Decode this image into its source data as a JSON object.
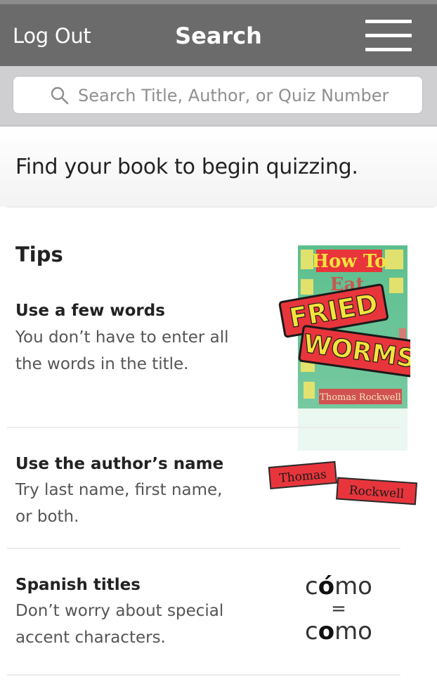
{
  "nav": {
    "logout_label": "Log Out",
    "title": "Search",
    "menu_icon": "hamburger-menu-icon"
  },
  "search": {
    "placeholder": "Search Title, Author, or Quiz Number",
    "icon": "search-icon"
  },
  "intro": {
    "text": "Find your book to begin quizzing."
  },
  "tips": {
    "heading": "Tips",
    "items": [
      {
        "title": "Use a few words",
        "desc_line1": "You don’t have to enter all",
        "desc_line2": "the words in the title."
      },
      {
        "title": "Use the author’s name",
        "desc_line1": "Try last name, first name,",
        "desc_line2": "or both."
      },
      {
        "title": "Spanish titles",
        "desc_line1": "Don’t worry about special",
        "desc_line2": "accent characters."
      }
    ]
  },
  "book_cover": {
    "line1": "How To",
    "line2": "Eat",
    "line3": "FRIED",
    "line4": "WORMS",
    "author": "Thomas Rockwell"
  },
  "author_example": {
    "first": "Thomas",
    "last": "Rockwell"
  },
  "spanish_example": {
    "accented_prefix": "c",
    "accented_vowel": "ó",
    "accented_suffix": "mo",
    "equals": "=",
    "plain_prefix": "c",
    "plain_vowel": "o",
    "plain_suffix": "mo"
  },
  "colors": {
    "nav_bg": "#6b6b6b",
    "search_bg": "#cfcfd2",
    "cover_green": "#5dbf8e",
    "tag_red": "#e8353c",
    "tag_yellow": "#f4e33c"
  }
}
